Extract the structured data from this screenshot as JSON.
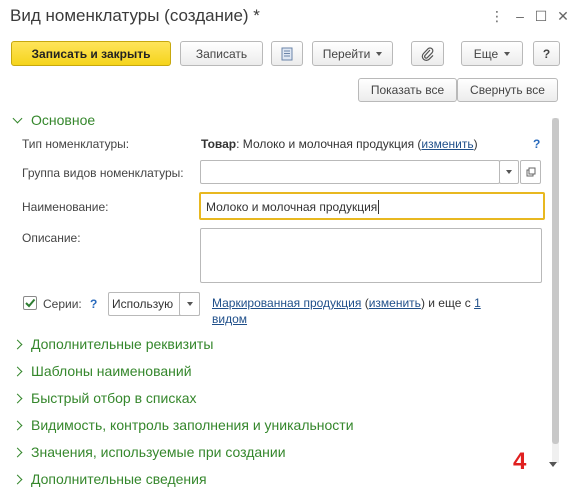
{
  "window": {
    "title": "Вид номенклатуры (создание) *"
  },
  "title_controls": {
    "more": "⋮",
    "minimize": "–",
    "maximize": "☐",
    "close": "✕"
  },
  "toolbar": {
    "save_close": "Записать и закрыть",
    "save": "Записать",
    "goto": "Перейти",
    "more": "Еще",
    "help": "?"
  },
  "secondary_toolbar": {
    "show_all": "Показать все",
    "collapse_all": "Свернуть все"
  },
  "main_section": {
    "title": "Основное"
  },
  "fields": {
    "type_label": "Тип номенклатуры:",
    "type_value_bold": "Товар",
    "type_value": ": Молоко и молочная продукция (",
    "type_change": "изменить",
    "type_close": ")",
    "group_label": "Группа видов номенклатуры:",
    "group_value": "",
    "name_label": "Наименование:",
    "name_value": "Молоко и молочная продукция",
    "desc_label": "Описание:",
    "desc_value": "",
    "series_label": "Серии:",
    "series_checked": true,
    "series_select": "Использую",
    "marked_link": "Маркированная продукция",
    "marked_open": " (",
    "marked_change": "изменить",
    "marked_tail": ") и еще с ",
    "one_link": "1",
    "one_tail": "видом",
    "help_mark": "?"
  },
  "sections": [
    "Дополнительные реквизиты",
    "Шаблоны наименований",
    "Быстрый отбор в списках",
    "Видимость, контроль заполнения и уникальности",
    "Значения, используемые при создании",
    "Дополнительные сведения"
  ],
  "overlay_number": "4",
  "colors": {
    "accent_green": "#35872c",
    "primary_yellow": "#f5d41b",
    "focus_border": "#e8b820",
    "badge_red": "#e02020"
  }
}
